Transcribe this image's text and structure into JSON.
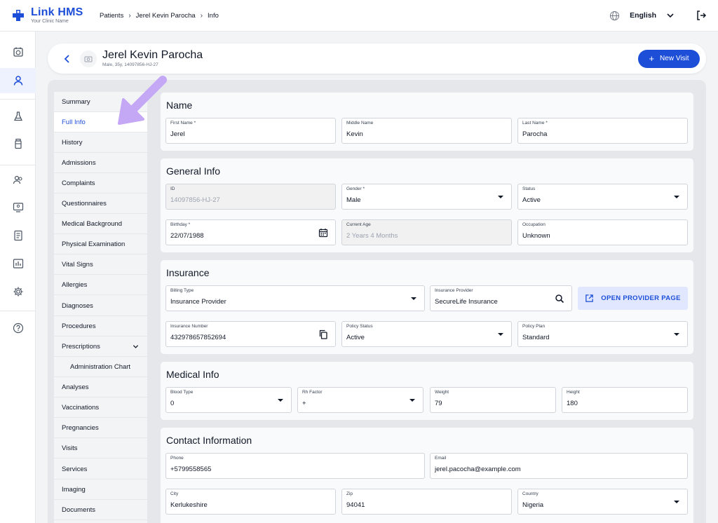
{
  "app": {
    "name": "Link HMS",
    "subtitle": "Your Clinic Name"
  },
  "breadcrumb": [
    "Patients",
    "Jerel Kevin Parocha",
    "Info"
  ],
  "language": "English",
  "patient": {
    "name": "Jerel Kevin Parocha",
    "summary": "Male, 35y, 14097856-HJ-27",
    "new_visit_label": "New Visit"
  },
  "subnav": [
    "Summary",
    "Full Info",
    "History",
    "Admissions",
    "Complaints",
    "Questionnaires",
    "Medical Background",
    "Physical Examination",
    "Vital Signs",
    "Allergies",
    "Diagnoses",
    "Procedures",
    "Prescriptions",
    "Administration Chart",
    "Analyses",
    "Vaccinations",
    "Pregnancies",
    "Visits",
    "Services",
    "Imaging",
    "Documents"
  ],
  "sections": {
    "name": {
      "title": "Name",
      "first": {
        "label": "First Name *",
        "value": "Jerel"
      },
      "middle": {
        "label": "Middle Name",
        "value": "Kevin"
      },
      "last": {
        "label": "Last Name *",
        "value": "Parocha"
      }
    },
    "general": {
      "title": "General Info",
      "id": {
        "label": "ID",
        "value": "14097856-HJ-27"
      },
      "gender": {
        "label": "Gender *",
        "value": "Male"
      },
      "status": {
        "label": "Status",
        "value": "Active"
      },
      "birthday": {
        "label": "Birthday *",
        "value": "22/07/1988"
      },
      "age": {
        "label": "Current Age",
        "value": "2 Years 4 Months"
      },
      "occupation": {
        "label": "Occupation",
        "value": "Unknown"
      }
    },
    "insurance": {
      "title": "Insurance",
      "billing": {
        "label": "Billing Type",
        "value": "Insurance Provider"
      },
      "provider": {
        "label": "Insurance Provider",
        "value": "SecureLife Insurance"
      },
      "open_provider_label": "OPEN PROVIDER PAGE",
      "number": {
        "label": "Insurance Number",
        "value": "432978657852694"
      },
      "policy_status": {
        "label": "Policy Status",
        "value": "Active"
      },
      "policy_plan": {
        "label": "Policy Plan",
        "value": "Standard"
      }
    },
    "medical": {
      "title": "Medical Info",
      "blood": {
        "label": "Blood Type",
        "value": "0"
      },
      "rh": {
        "label": "Rh Factor",
        "value": "+"
      },
      "weight": {
        "label": "Weight",
        "value": "79"
      },
      "height": {
        "label": "Height",
        "value": "180"
      }
    },
    "contact": {
      "title": "Contact Information",
      "phone": {
        "label": "Phone",
        "value": "+5799558565"
      },
      "email": {
        "label": "Email",
        "value": "jerel.pacocha@example.com"
      },
      "city": {
        "label": "City",
        "value": "Kerlukeshire"
      },
      "zip": {
        "label": "Zip",
        "value": "94041"
      },
      "country": {
        "label": "Country",
        "value": "Nigeria"
      }
    }
  },
  "colors": {
    "accent": "#1d4ed8",
    "pointer": "#c4a7f5"
  }
}
